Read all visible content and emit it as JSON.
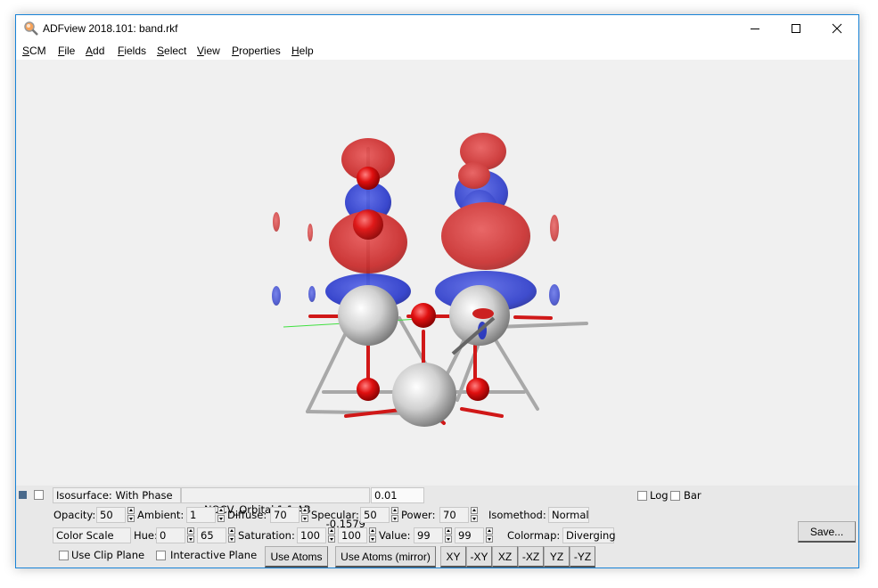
{
  "window": {
    "title": "ADFview 2018.101: band.rkf",
    "controls": [
      "minimize",
      "maximize",
      "close"
    ]
  },
  "menubar": {
    "items": [
      {
        "label": "SCM",
        "mnemonic": "S",
        "rest": "CM"
      },
      {
        "label": "File",
        "mnemonic": "F",
        "rest": "ile"
      },
      {
        "label": "Add",
        "mnemonic": "A",
        "rest": "dd"
      },
      {
        "label": "Fields",
        "mnemonic": "F",
        "rest": "ields"
      },
      {
        "label": "Select",
        "mnemonic": "S",
        "rest": "elect"
      },
      {
        "label": "View",
        "mnemonic": "V",
        "rest": "iew"
      },
      {
        "label": "Properties",
        "mnemonic": "P",
        "rest": "roperties"
      },
      {
        "label": "Help",
        "mnemonic": "H",
        "rest": "elp"
      }
    ]
  },
  "viewport": {
    "description": "3D molecular view with isosurface orbitals (red/blue phases)",
    "colors": {
      "positive": "#cc2020",
      "negative": "#2030c0",
      "atom_metal": "#d8d8d8",
      "atom_oxygen": "#e01010",
      "background": "#f0f0f0"
    }
  },
  "panel": {
    "row1": {
      "visible_checked": true,
      "select_checked": false,
      "surface_type": "Isosurface: With Phase",
      "field_name": "NOCV_Orbital 1 1 AB",
      "field_value": "-0.1579",
      "iso_value": "0.01",
      "log_label": "Log",
      "log_checked": false,
      "bar_label": "Bar",
      "bar_checked": false
    },
    "row2": {
      "opacity_label": "Opacity:",
      "opacity": "50",
      "ambient_label": "Ambient:",
      "ambient": "1",
      "diffuse_label": "Diffuse:",
      "diffuse": "70",
      "specular_label": "Specular:",
      "specular": "50",
      "power_label": "Power:",
      "power": "70",
      "isomethod_label": "Isomethod:",
      "isomethod": "Normal"
    },
    "row3": {
      "color_scale": "Color Scale",
      "hue_label": "Hue:",
      "hue_min": "0",
      "hue_max": "65",
      "saturation_label": "Saturation:",
      "saturation_min": "100",
      "saturation_max": "100",
      "value_label": "Value:",
      "value_min": "99",
      "value_max": "99",
      "colormap_label": "Colormap:",
      "colormap": "Diverging",
      "save_button": "Save..."
    },
    "row4": {
      "clip_plane_label": "Use Clip Plane",
      "clip_plane_checked": false,
      "interactive_plane_label": "Interactive Plane",
      "interactive_plane_checked": false,
      "use_atoms_button": "Use Atoms",
      "use_atoms_mirror_button": "Use Atoms (mirror)",
      "plane_buttons": [
        "XY",
        "-XY",
        "XZ",
        "-XZ",
        "YZ",
        "-YZ"
      ]
    }
  }
}
